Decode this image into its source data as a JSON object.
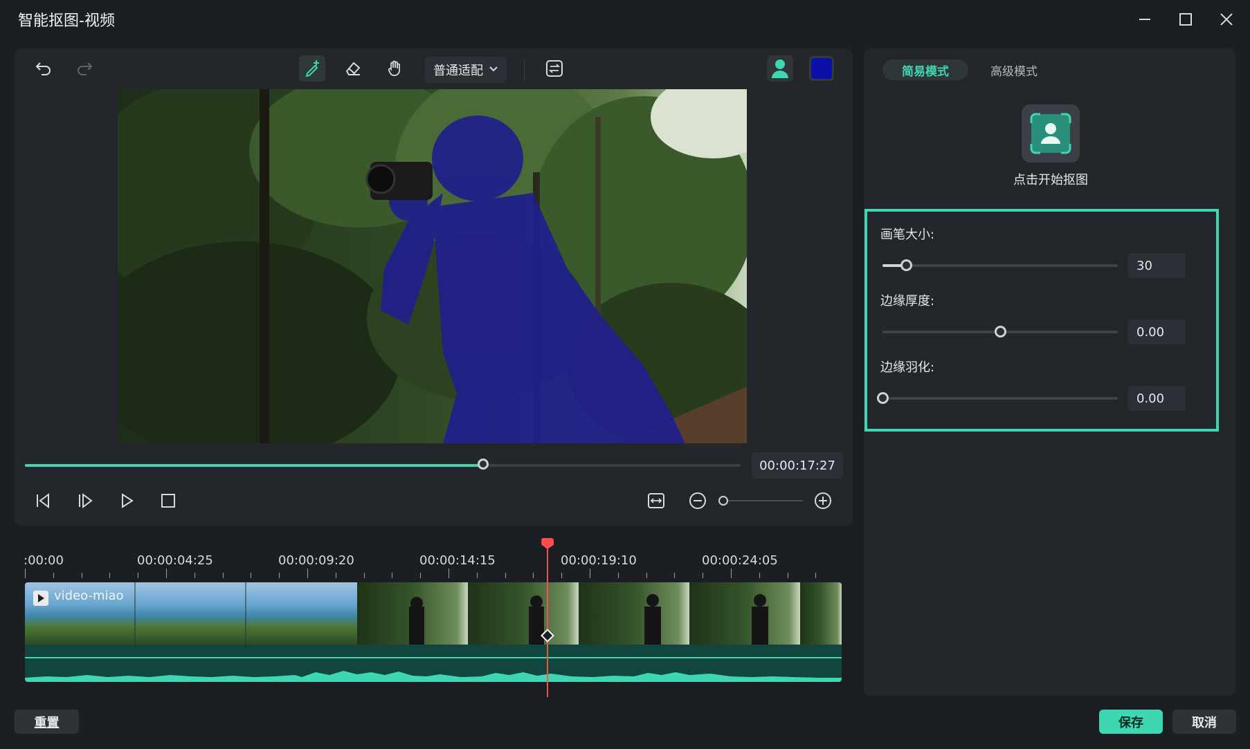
{
  "window": {
    "title": "智能抠图-视频"
  },
  "toolbar": {
    "fit_mode": "普通适配",
    "mask_color": "#0a10a8"
  },
  "playback": {
    "timecode": "00:00:17:27",
    "progress": 0.64,
    "zoom": 0.0
  },
  "timeline": {
    "ruler_labels": [
      ":00:00",
      "00:00:04:25",
      "00:00:09:20",
      "00:00:14:15",
      "00:00:19:10",
      "00:00:24:05"
    ],
    "clip_name": "video-miao",
    "playhead": 0.64
  },
  "right_panel": {
    "tabs": [
      "简易模式",
      "高级模式"
    ],
    "active_tab": "简易模式",
    "start_matting": "点击开始抠图",
    "brush_size": {
      "label": "画笔大小:",
      "value": "30",
      "level": 0.1
    },
    "edge_thickness": {
      "label": "边缘厚度:",
      "value": "0.00",
      "level": 0.5
    },
    "edge_feather": {
      "label": "边缘羽化:",
      "value": "0.00",
      "level": 0.0
    }
  },
  "footer": {
    "reset": "重置",
    "save": "保存",
    "cancel": "取消"
  },
  "colors": {
    "accent": "#3ed6b3",
    "playhead": "#ff4d4f"
  }
}
